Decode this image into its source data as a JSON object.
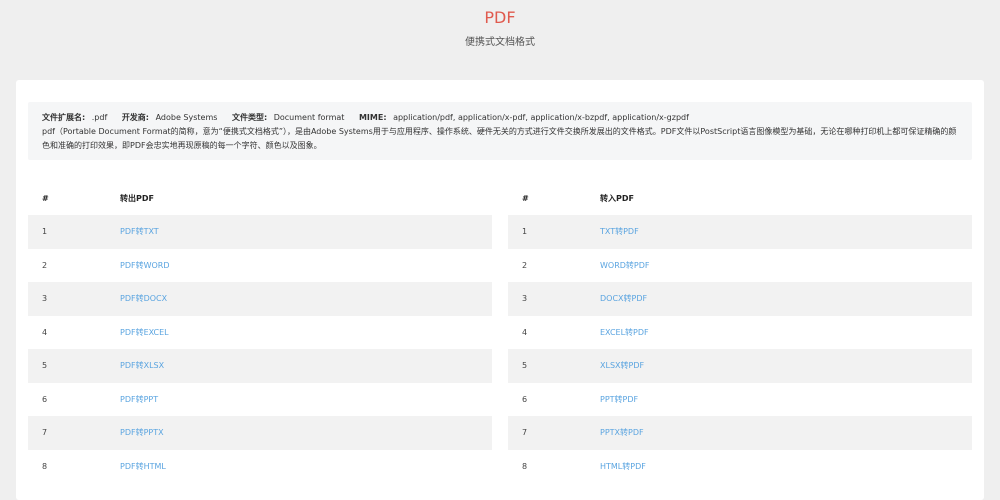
{
  "header": {
    "title": "PDF",
    "subtitle": "便携式文档格式"
  },
  "info": {
    "ext_label": "文件扩展名:",
    "ext_value": ".pdf",
    "dev_label": "开发商:",
    "dev_value": "Adobe Systems",
    "type_label": "文件类型:",
    "type_value": "Document format",
    "mime_label": "MIME:",
    "mime_value": "application/pdf, application/x-pdf, application/x-bzpdf, application/x-gzpdf",
    "description": "pdf（Portable Document Format的简称，意为“便携式文档格式”），是由Adobe Systems用于与应用程序、操作系统、硬件无关的方式进行文件交换所发展出的文件格式。PDF文件以PostScript语言图像模型为基础，无论在哪种打印机上都可保证精确的颜色和准确的打印效果，即PDF会忠实地再现原稿的每一个字符、颜色以及图象。"
  },
  "export_table": {
    "header_num": "#",
    "header_title": "转出PDF",
    "rows": [
      {
        "num": "1",
        "label": "PDF转TXT"
      },
      {
        "num": "2",
        "label": "PDF转WORD"
      },
      {
        "num": "3",
        "label": "PDF转DOCX"
      },
      {
        "num": "4",
        "label": "PDF转EXCEL"
      },
      {
        "num": "5",
        "label": "PDF转XLSX"
      },
      {
        "num": "6",
        "label": "PDF转PPT"
      },
      {
        "num": "7",
        "label": "PDF转PPTX"
      },
      {
        "num": "8",
        "label": "PDF转HTML"
      }
    ]
  },
  "import_table": {
    "header_num": "#",
    "header_title": "转入PDF",
    "rows": [
      {
        "num": "1",
        "label": "TXT转PDF"
      },
      {
        "num": "2",
        "label": "WORD转PDF"
      },
      {
        "num": "3",
        "label": "DOCX转PDF"
      },
      {
        "num": "4",
        "label": "EXCEL转PDF"
      },
      {
        "num": "5",
        "label": "XLSX转PDF"
      },
      {
        "num": "6",
        "label": "PPT转PDF"
      },
      {
        "num": "7",
        "label": "PPTX转PDF"
      },
      {
        "num": "8",
        "label": "HTML转PDF"
      }
    ]
  },
  "colors": {
    "title": "#e05a4e",
    "link": "#5aa4e0",
    "background": "#efefef"
  }
}
